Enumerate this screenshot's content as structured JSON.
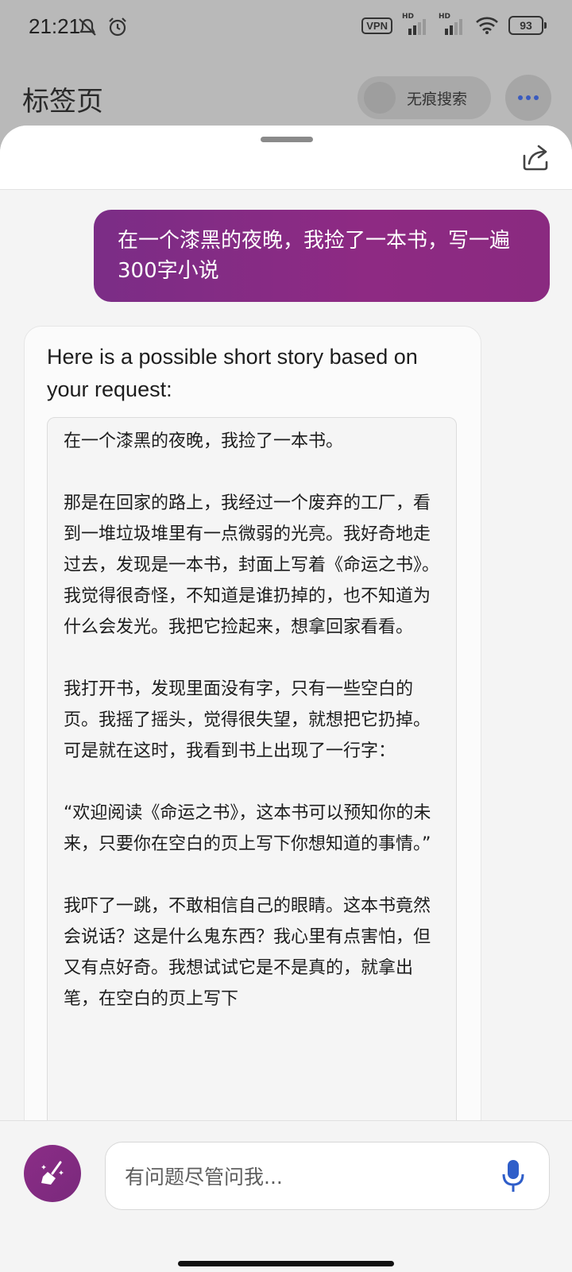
{
  "status_bar": {
    "time": "21:21",
    "vpn": "VPN",
    "hd1": "HD",
    "hd2": "HD",
    "battery": "93"
  },
  "header": {
    "title": "标签页",
    "private_search_label": "无痕搜索"
  },
  "conversation": {
    "user_message": "在一个漆黑的夜晚，我捡了一本书，写一遍300字小说",
    "bot_intro": "Here is a possible short story based on your request:",
    "story_paragraphs": [
      "在一个漆黑的夜晚，我捡了一本书。",
      "那是在回家的路上，我经过一个废弃的工厂，看到一堆垃圾堆里有一点微弱的光亮。我好奇地走过去，发现是一本书，封面上写着《命运之书》。我觉得很奇怪，不知道是谁扔掉的，也不知道为什么会发光。我把它捡起来，想拿回家看看。",
      "我打开书，发现里面没有字，只有一些空白的页。我摇了摇头，觉得很失望，就想把它扔掉。可是就在这时，我看到书上出现了一行字：",
      "“欢迎阅读《命运之书》，这本书可以预知你的未来，只要你在空白的页上写下你想知道的事情。”",
      "我吓了一跳，不敢相信自己的眼睛。这本书竟然会说话？这是什么鬼东西？我心里有点害怕，但又有点好奇。我想试试它是不是真的，就拿出笔，在空白的页上写下"
    ]
  },
  "input": {
    "placeholder": "有问题尽管问我..."
  },
  "colors": {
    "accent": "#8b2c87",
    "mic": "#2f5ec9"
  }
}
